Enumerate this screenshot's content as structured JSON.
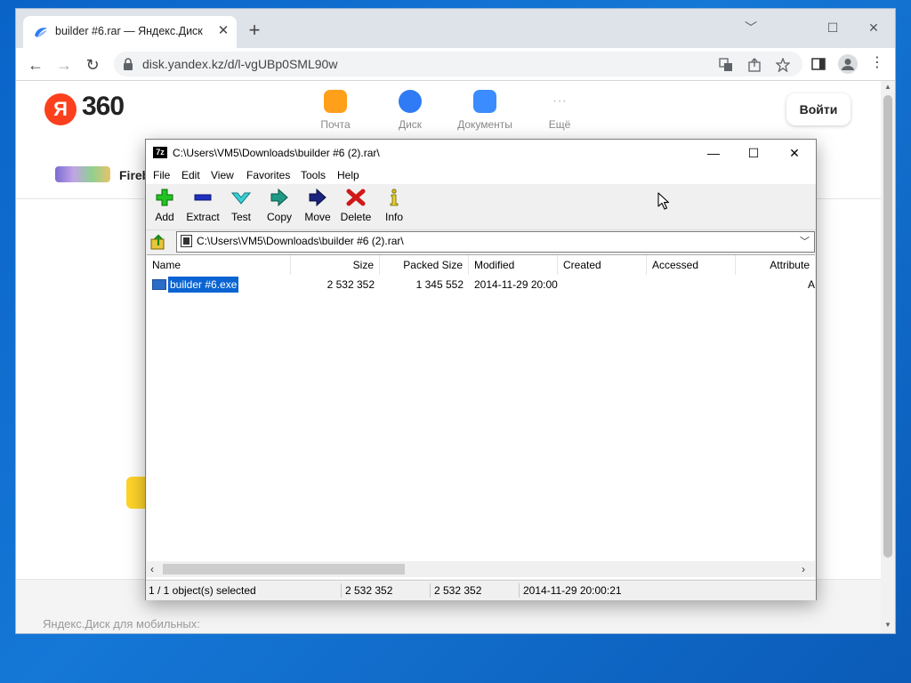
{
  "browser": {
    "tab_title": "builder #6.rar — Яндекс.Диск",
    "url": "disk.yandex.kz/d/l-vgUBp0SML90w",
    "win_controls": {
      "minimize": "﹀",
      "maximize": "☐",
      "close": "✕"
    }
  },
  "yandex": {
    "logo_letter": "Я",
    "logo_number": "360",
    "services": [
      {
        "label": "Почта",
        "color": "#ff9f1a"
      },
      {
        "label": "Диск",
        "color": "#2f7bf6"
      },
      {
        "label": "Документы",
        "color": "#3b8cff"
      },
      {
        "label": "Ещё",
        "color": "#bdbdbd"
      }
    ],
    "login": "Войти",
    "app_name": "Fireb",
    "mobile_text": "Яндекс.Диск для мобильных:"
  },
  "zip": {
    "title": "C:\\Users\\VM5\\Downloads\\builder #6 (2).rar\\",
    "app_icon": "7z",
    "menu": [
      "File",
      "Edit",
      "View",
      "Favorites",
      "Tools",
      "Help"
    ],
    "tools": [
      {
        "label": "Add",
        "icon": "plus-icon"
      },
      {
        "label": "Extract",
        "icon": "minus-icon"
      },
      {
        "label": "Test",
        "icon": "check-icon"
      },
      {
        "label": "Copy",
        "icon": "copy-arrow-icon"
      },
      {
        "label": "Move",
        "icon": "move-arrow-icon"
      },
      {
        "label": "Delete",
        "icon": "delete-x-icon"
      },
      {
        "label": "Info",
        "icon": "info-icon"
      }
    ],
    "path": "C:\\Users\\VM5\\Downloads\\builder #6 (2).rar\\",
    "columns": [
      "Name",
      "Size",
      "Packed Size",
      "Modified",
      "Created",
      "Accessed",
      "Attribute"
    ],
    "rows": [
      {
        "name": "builder #6.exe",
        "size": "2 532 352",
        "packed": "1 345 552",
        "modified": "2014-11-29 20:00",
        "created": "",
        "accessed": "",
        "attr": "A"
      }
    ],
    "status": {
      "selected": "1 / 1 object(s) selected",
      "size": "2 532 352",
      "packed": "2 532 352",
      "modified": "2014-11-29 20:00:21"
    }
  }
}
